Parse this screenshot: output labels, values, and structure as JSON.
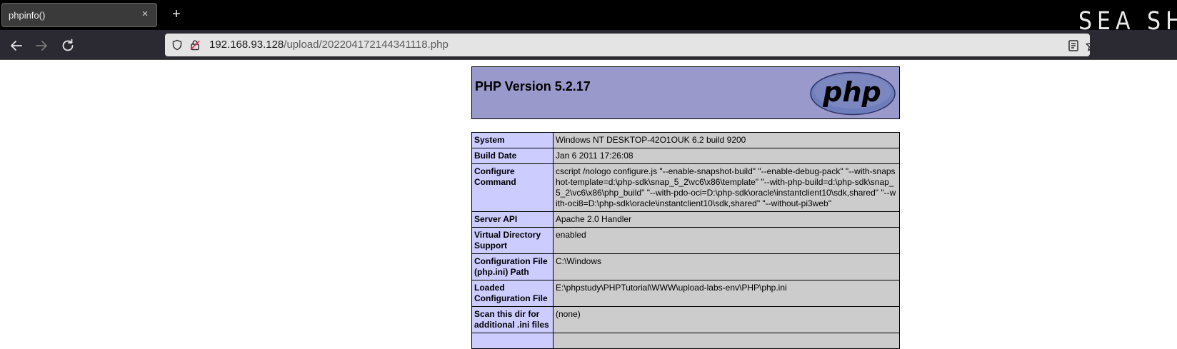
{
  "browser": {
    "tab_title": "phpinfo()",
    "tab_close": "×",
    "new_tab": "+",
    "watermark": "SEA SHE",
    "url_host": "192.168.93.128",
    "url_path": "/upload/202204172144341118.php"
  },
  "php": {
    "version": "PHP Version 5.2.17",
    "logo_text": "php",
    "rows": [
      {
        "label": "System",
        "value": "Windows NT DESKTOP-42O1OUK 6.2 build 9200"
      },
      {
        "label": "Build Date",
        "value": "Jan 6 2011 17:26:08"
      },
      {
        "label": "Configure Command",
        "value": "cscript /nologo configure.js \"--enable-snapshot-build\" \"--enable-debug-pack\" \"--with-snapshot-template=d:\\php-sdk\\snap_5_2\\vc6\\x86\\template\" \"--with-php-build=d:\\php-sdk\\snap_5_2\\vc6\\x86\\php_build\" \"--with-pdo-oci=D:\\php-sdk\\oracle\\instantclient10\\sdk,shared\" \"--with-oci8=D:\\php-sdk\\oracle\\instantclient10\\sdk,shared\" \"--without-pi3web\""
      },
      {
        "label": "Server API",
        "value": "Apache 2.0 Handler"
      },
      {
        "label": "Virtual Directory Support",
        "value": "enabled"
      },
      {
        "label": "Configuration File (php.ini) Path",
        "value": "C:\\Windows"
      },
      {
        "label": "Loaded Configuration File",
        "value": "E:\\phpstudy\\PHPTutorial\\WWW\\upload-labs-env\\PHP\\php.ini"
      },
      {
        "label": "Scan this dir for additional .ini files",
        "value": "(none)"
      },
      {
        "label": "",
        "value": ""
      }
    ]
  }
}
